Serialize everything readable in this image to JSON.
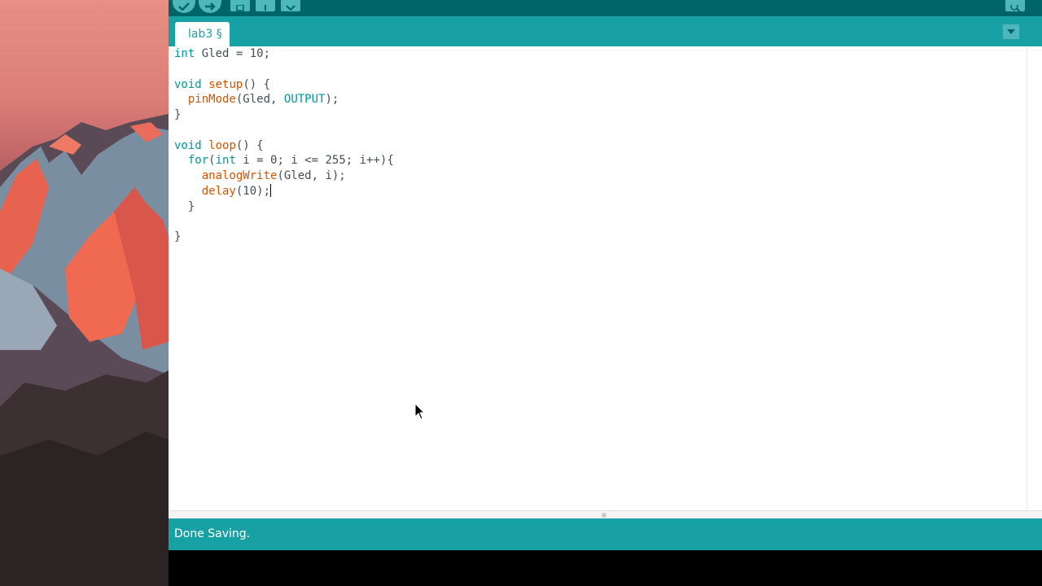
{
  "toolbar": {
    "buttons": [
      "verify-icon",
      "upload-icon",
      "new-icon",
      "open-icon",
      "save-icon"
    ],
    "right_button": "serial-monitor-icon"
  },
  "tabs": [
    {
      "label": "lab3 §",
      "active": true
    }
  ],
  "editor": {
    "lines": [
      "int Gled = 10;",
      "",
      "void setup() {",
      "  pinMode(Gled, OUTPUT);",
      "}",
      "",
      "void loop() {",
      "  for(int i = 0; i <= 255; i++){",
      "    analogWrite(Gled, i);",
      "    delay(10);",
      "  }",
      "",
      "}"
    ]
  },
  "status": {
    "message": "Done Saving."
  },
  "colors": {
    "toolbar": "#006468",
    "tabbar": "#17a1a5",
    "keyword": "#00979c",
    "function": "#d35400",
    "text": "#434f54"
  }
}
